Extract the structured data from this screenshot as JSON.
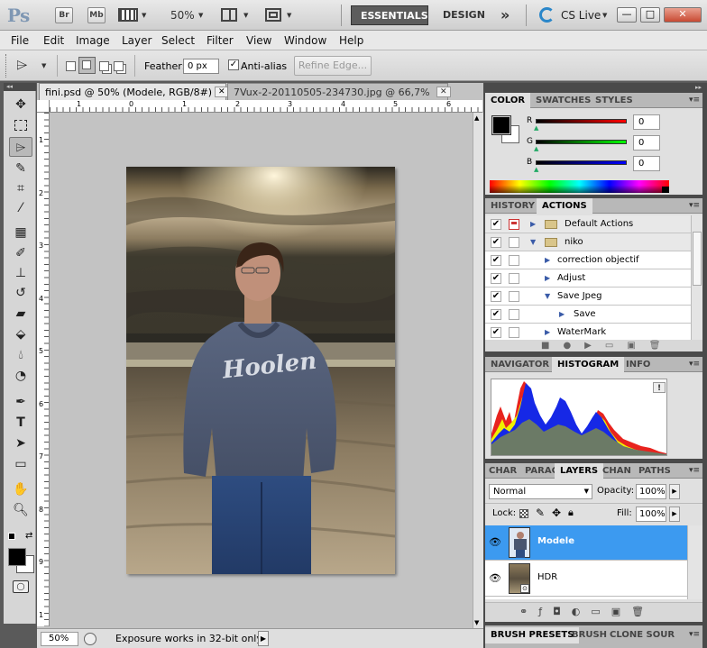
{
  "appbar": {
    "logo": "Ps",
    "br": "Br",
    "mb": "Mb",
    "zoom": "50%",
    "workspace_active": "ESSENTIALS",
    "workspace_other": "DESIGN",
    "more": "»",
    "cs_live": "CS Live",
    "win_min": "—",
    "win_max": "□",
    "win_close": "✕"
  },
  "menu": [
    "File",
    "Edit",
    "Image",
    "Layer",
    "Select",
    "Filter",
    "View",
    "Window",
    "Help"
  ],
  "options": {
    "feather_label": "Feather:",
    "feather_value": "0 px",
    "antialias_label": "Anti-alias",
    "antialias_check": "✓",
    "refine_label": "Refine Edge..."
  },
  "document": {
    "tab_active": "fini.psd @ 50% (Modele, RGB/8#)",
    "tab_inactive": "7Vux-2-20110505-234730.jpg @ 66,7% ...",
    "tab_close": "✕",
    "ruler_marks": [
      "1",
      "0",
      "1",
      "2",
      "3",
      "4",
      "5",
      "6"
    ],
    "vruler_marks": [
      "1",
      "2",
      "3",
      "4",
      "5",
      "6",
      "7",
      "8",
      "9",
      "1"
    ],
    "status_zoom": "50%",
    "status_msg": "Exposure works in 32-bit only",
    "status_arrow": "▶"
  },
  "color_panel": {
    "tabs": [
      "COLOR",
      "SWATCHES",
      "STYLES"
    ],
    "channels": [
      {
        "label": "R",
        "value": "0"
      },
      {
        "label": "G",
        "value": "0"
      },
      {
        "label": "B",
        "value": "0"
      }
    ],
    "fg_color": "#000000",
    "bg_color": "#ffffff"
  },
  "history_panel": {
    "tabs": [
      "HISTORY",
      "ACTIONS"
    ],
    "check": "✔",
    "rows": [
      {
        "label": "Default Actions",
        "indent": 0,
        "type": "folder"
      },
      {
        "label": "niko",
        "indent": 0,
        "type": "folder-open"
      },
      {
        "label": "correction objectif",
        "indent": 1,
        "type": "action"
      },
      {
        "label": "Adjust",
        "indent": 1,
        "type": "action"
      },
      {
        "label": "Save Jpeg",
        "indent": 1,
        "type": "action-open"
      },
      {
        "label": "Save",
        "indent": 2,
        "type": "action"
      },
      {
        "label": "WaterMark",
        "indent": 1,
        "type": "action"
      }
    ]
  },
  "navigator_panel": {
    "tabs": [
      "NAVIGATOR",
      "HISTOGRAM",
      "INFO"
    ],
    "warning": "!"
  },
  "layers_panel": {
    "tabs": [
      "CHAR",
      "PARAG",
      "LAYERS",
      "CHAN",
      "PATHS"
    ],
    "blend_mode": "Normal",
    "opacity_label": "Opacity:",
    "opacity_value": "100%",
    "lock_label": "Lock:",
    "fill_label": "Fill:",
    "fill_value": "100%",
    "layers": [
      {
        "name": "Modele",
        "selected": true
      },
      {
        "name": "HDR",
        "selected": false
      }
    ]
  },
  "bottom_panel": {
    "tabs": [
      "BRUSH PRESETS",
      "BRUSH",
      "CLONE SOUR"
    ]
  },
  "photo": {
    "sweatshirt_text": "Hoolen"
  }
}
